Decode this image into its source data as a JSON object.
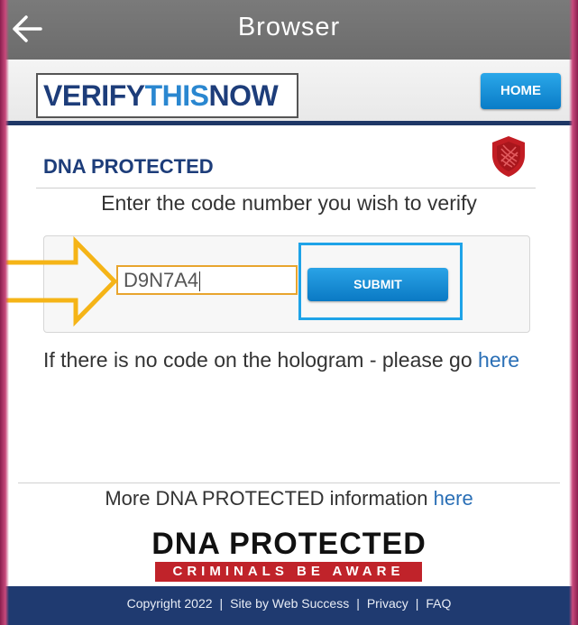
{
  "browser": {
    "title": "Browser",
    "back_icon": "arrow-left-icon"
  },
  "header": {
    "logo_part1": "VERIFY",
    "logo_part2": "THIS",
    "logo_part3": "NOW",
    "home_label": "HOME"
  },
  "main": {
    "section_title": "DNA PROTECTED",
    "shield_icon": "shield-icon",
    "prompt": "Enter the code number you wish to verify",
    "code_value": "D9N7A4",
    "submit_label": "SUBMIT",
    "nocode_text": "If there is no code on the hologram - please go",
    "nocode_link": "here",
    "more_text": "More DNA PROTECTED information",
    "more_link": "here"
  },
  "brand": {
    "name": "DNA PROTECTED",
    "tagline": "CRIMINALS BE AWARE"
  },
  "footer": {
    "copyright": "Copyright 2022",
    "site_by": "Site by Web Success",
    "privacy": "Privacy",
    "faq": "FAQ",
    "separator": "|"
  },
  "colors": {
    "navy": "#1e3766",
    "accent_blue": "#1ea3e8",
    "highlight_orange": "#e8a52e",
    "brand_red": "#c0232a"
  }
}
